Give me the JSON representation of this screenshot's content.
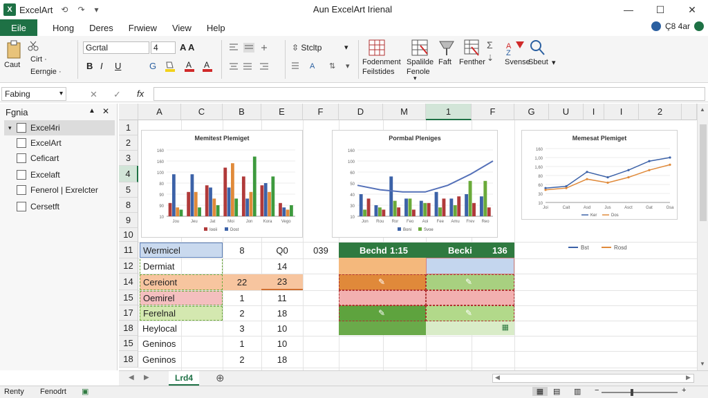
{
  "app": {
    "name": "ExcelArt",
    "doc_title": "Aun ExcelArt Irienal",
    "logo_letter": "X"
  },
  "qat": [
    "⟲",
    "↷",
    "▾"
  ],
  "window_controls": [
    "—",
    "☐",
    "✕"
  ],
  "menu": {
    "file": "Eile",
    "items": [
      "Hong",
      "Deres",
      "Frwiew",
      "View",
      "Help"
    ],
    "right_text": "Ç8 4ar"
  },
  "ribbon": {
    "clipboard": {
      "cut": "Caut",
      "copy": "Cirt ·",
      "format": "Eerngie ·"
    },
    "font_name": "Gcrtal",
    "font_size": "4",
    "styles_label": "Stcltp",
    "groups": [
      {
        "label1": "Fodenment",
        "label2": "Feilstides",
        "color": "#b03030"
      },
      {
        "label1": "Spalilde",
        "label2": "Fenole",
        "color": "#b03030"
      },
      {
        "label1": "Faft",
        "label2": "",
        "color": "#444"
      },
      {
        "label1": "Fenther",
        "label2": "",
        "color": "#444"
      },
      {
        "label1": "Svense",
        "label2": "",
        "color": "#b03030"
      },
      {
        "label1": "Sbeut",
        "label2": "",
        "color": "#2a5fa0"
      }
    ]
  },
  "formula": {
    "name_box": "Fabing",
    "fx": "fx"
  },
  "navpane": {
    "header": "Fgnia",
    "items": [
      "Excel4ri",
      "ExcelArt",
      "Ceficart",
      "Excelaft",
      "Fenerol | Exrelcter",
      "Cersetft"
    ]
  },
  "grid": {
    "columns": [
      "A",
      "C",
      "B",
      "E",
      "F",
      "D",
      "M",
      "1",
      "F",
      "G",
      "U",
      "I",
      "I",
      "2"
    ],
    "rows": [
      "1",
      "2",
      "3",
      "4",
      "5",
      "8",
      "9",
      "10",
      "11",
      "12",
      "14",
      "15",
      "17",
      "18",
      "15",
      "18"
    ],
    "cells": {
      "r11": [
        "Wermicel",
        "8",
        "Q0",
        "039"
      ],
      "r12": [
        "Dermiat",
        "",
        "14"
      ],
      "r14": [
        "Cereiont",
        "22",
        "23"
      ],
      "r15": [
        "Oemirel",
        "1",
        "11"
      ],
      "r17": [
        "Ferelnal",
        "2",
        "18"
      ],
      "r18": [
        "Heylocal",
        "3",
        "10"
      ],
      "r15b": [
        "Geninos",
        "1",
        "10"
      ],
      "r18b": [
        "Geninos",
        "2",
        "18"
      ]
    },
    "table_header": [
      "Bechd",
      "1:15",
      "Becki",
      "136"
    ]
  },
  "charts": [
    {
      "title": "Memitest Plemiget",
      "type": "bar",
      "y_ticks": [
        "160",
        "160",
        "100",
        "80",
        "90",
        "90",
        "10"
      ],
      "categories": [
        "Jou",
        "Jeu",
        "Jat",
        "Moi",
        "Jon",
        "Kora",
        "Vego"
      ],
      "series": [
        {
          "color": "#b03a3a",
          "values": [
            30,
            55,
            70,
            110,
            90,
            70,
            30
          ]
        },
        {
          "color": "#3c62a8",
          "values": [
            95,
            95,
            65,
            65,
            40,
            75,
            20
          ]
        },
        {
          "color": "#e08a3a",
          "values": [
            20,
            55,
            40,
            120,
            55,
            55,
            15
          ]
        },
        {
          "color": "#3e9a3e",
          "values": [
            15,
            20,
            25,
            40,
            135,
            90,
            25
          ]
        }
      ],
      "legend": [
        "Iooii",
        "Dost"
      ]
    },
    {
      "title": "Pormbal Pleniges",
      "type": "combo",
      "y_ticks": [
        "160",
        "100",
        "60",
        "50",
        "40",
        "30",
        "10"
      ],
      "line_values": [
        70,
        60,
        55,
        55,
        70,
        95,
        125
      ],
      "categories": [
        "Jon",
        "Rou",
        "Ror",
        "Feo",
        "Aoi",
        "Fee",
        "Amu",
        "Frev",
        "Reo"
      ],
      "bars": [
        {
          "color": "#3c62a8",
          "values": [
            50,
            25,
            90,
            40,
            35,
            55,
            40,
            50,
            45
          ]
        },
        {
          "color": "#6aaa3a",
          "values": [
            15,
            20,
            35,
            40,
            30,
            20,
            25,
            80,
            80
          ]
        },
        {
          "color": "#b03a3a",
          "values": [
            40,
            15,
            20,
            15,
            30,
            40,
            45,
            30,
            20
          ]
        }
      ],
      "legend": [
        "Boni",
        "Svoe"
      ]
    },
    {
      "title": "Memesat Plemiget",
      "type": "line",
      "y_ticks": [
        "160",
        "1,00",
        "1,60",
        "80",
        "60",
        "30",
        "10"
      ],
      "categories": [
        "Joi",
        "Cait",
        "Asd",
        "Jus",
        "Asct",
        "Gat",
        "Gsa"
      ],
      "series": [
        {
          "color": "#3c62a8",
          "values": [
            40,
            45,
            85,
            70,
            90,
            115,
            125
          ]
        },
        {
          "color": "#e08a3a",
          "values": [
            35,
            40,
            65,
            55,
            70,
            90,
            105
          ]
        }
      ],
      "legend": [
        "Ker",
        "Dos"
      ]
    }
  ],
  "chart3_legend2": [
    "Bst",
    "Rosd"
  ],
  "sheet": {
    "tab": "Lrd4",
    "add": "⊕"
  },
  "status": {
    "left": "Renty",
    "mid": "Fenodrt",
    "zoom_icons": [
      "▦",
      "▤",
      "▥"
    ]
  }
}
